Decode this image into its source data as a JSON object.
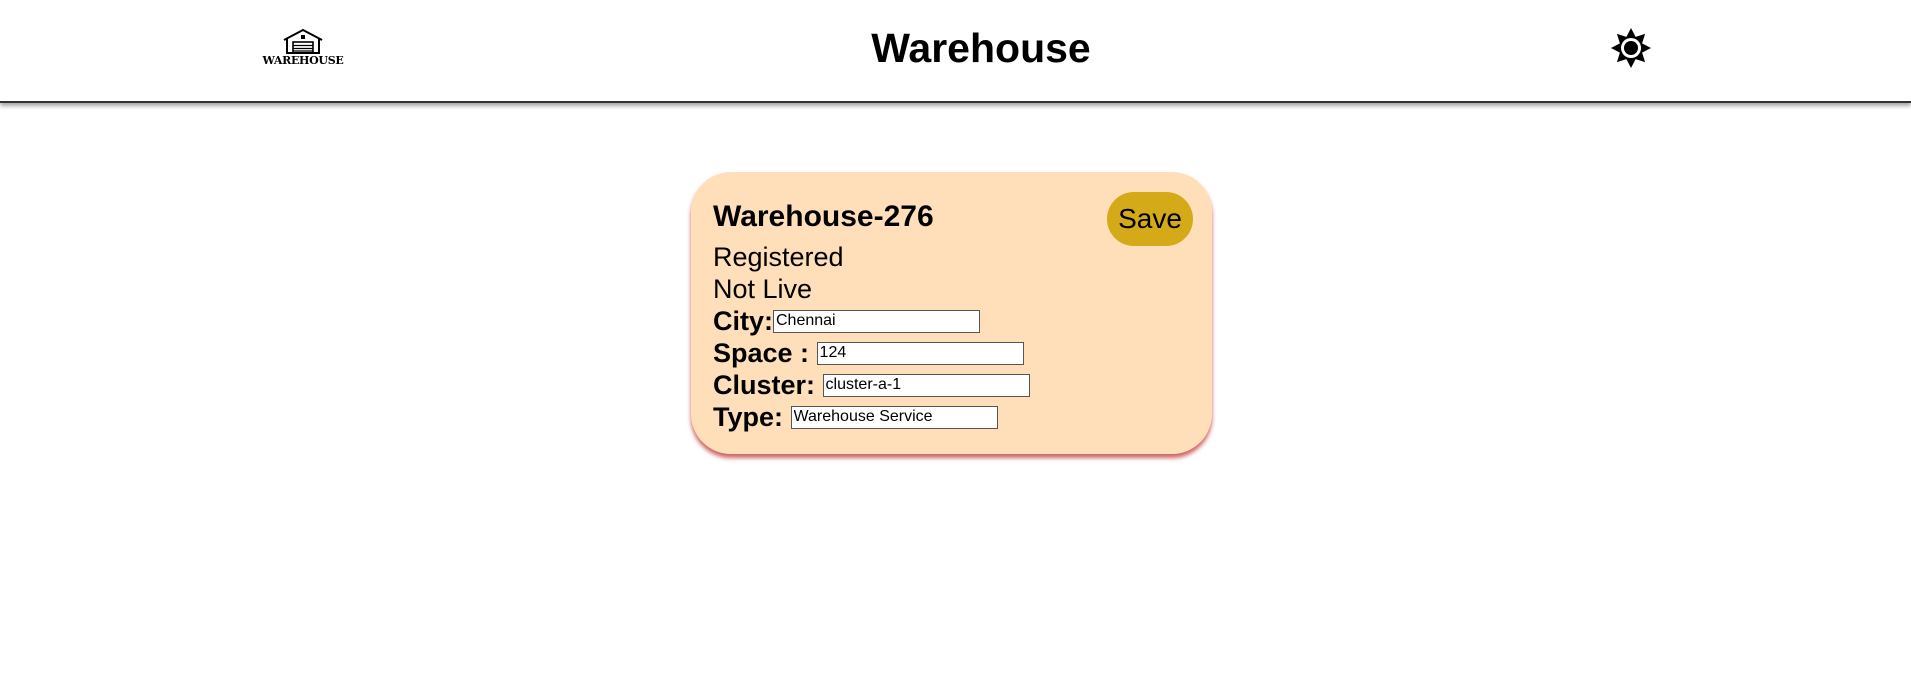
{
  "header": {
    "logo_text": "WAREHOUSE",
    "title": "Warehouse",
    "theme_icon": "sun-icon"
  },
  "card": {
    "title": "Warehouse-276",
    "save_label": "Save",
    "status_registration": "Registered",
    "status_live": "Not Live",
    "fields": {
      "city": {
        "label": "City:",
        "value": "Chennai"
      },
      "space": {
        "label": "Space : ",
        "value": "124"
      },
      "cluster": {
        "label": "Cluster: ",
        "value": "cluster-a-1"
      },
      "type": {
        "label": "Type: ",
        "value": "Warehouse Service"
      }
    }
  },
  "colors": {
    "card_background": "#ffdfb9",
    "save_button": "#d4aa18",
    "card_shadow": "#be3232"
  }
}
